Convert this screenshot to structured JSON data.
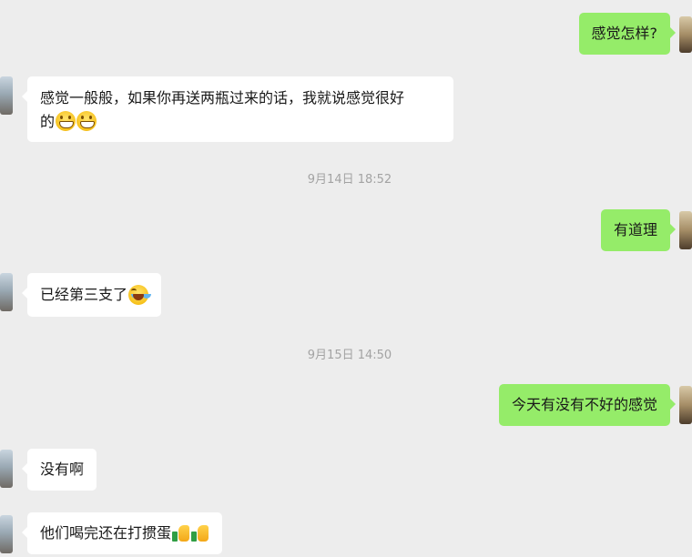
{
  "conversation": {
    "messages": [
      {
        "side": "out",
        "text": "感觉怎样?"
      },
      {
        "side": "in",
        "line1": "感觉一般般，如果你再送两瓶过来的话，我就说感觉很好",
        "line2": "的",
        "emoji": [
          "grin",
          "grin"
        ]
      },
      {
        "timestamp": "9月14日 18:52"
      },
      {
        "side": "out",
        "text": "有道理"
      },
      {
        "side": "in",
        "text": "已经第三支了",
        "emoji": [
          "laugh"
        ]
      },
      {
        "timestamp": "9月15日 14:50"
      },
      {
        "side": "out",
        "text": "今天有没有不好的感觉"
      },
      {
        "side": "in",
        "text": "没有啊"
      },
      {
        "side": "in",
        "text": "他们喝完还在打掼蛋",
        "emoji": [
          "thumbs-up",
          "thumbs-up"
        ]
      }
    ]
  },
  "colors": {
    "background": "#ededed",
    "outgoing_bubble": "#95ec69",
    "incoming_bubble": "#ffffff",
    "timestamp_text": "#a3a3a3"
  }
}
